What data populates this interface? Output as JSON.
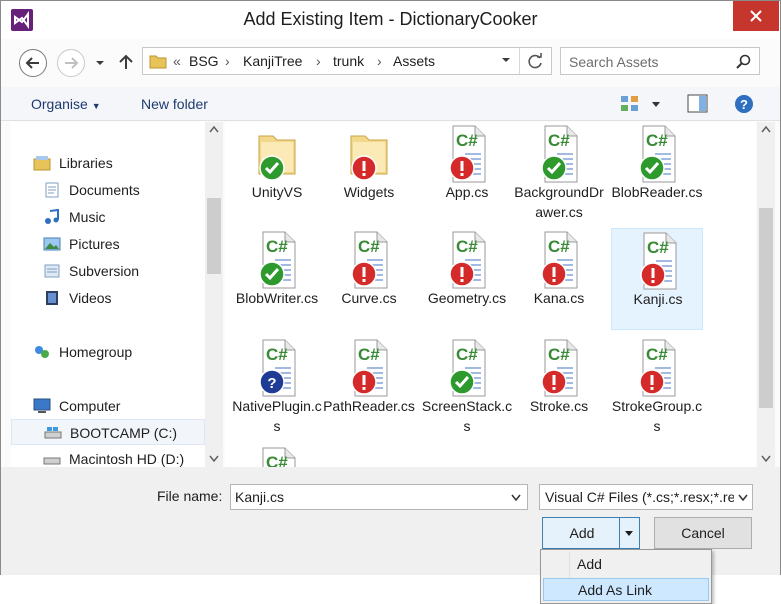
{
  "window": {
    "title": "Add Existing Item - DictionaryCooker"
  },
  "address": {
    "chevrons": "«",
    "crumbs": [
      "BSG",
      "KanjiTree",
      "trunk",
      "Assets"
    ]
  },
  "search": {
    "placeholder": "Search Assets"
  },
  "toolbar": {
    "organise_label": "Organise",
    "new_folder_label": "New folder"
  },
  "nav_pane": {
    "items": [
      {
        "label": "Libraries",
        "icon": "libraries-icon"
      },
      {
        "label": "Documents",
        "icon": "documents-icon"
      },
      {
        "label": "Music",
        "icon": "music-icon"
      },
      {
        "label": "Pictures",
        "icon": "pictures-icon"
      },
      {
        "label": "Subversion",
        "icon": "subversion-icon"
      },
      {
        "label": "Videos",
        "icon": "videos-icon"
      },
      {
        "label": "Homegroup",
        "icon": "homegroup-icon"
      },
      {
        "label": "Computer",
        "icon": "computer-icon"
      },
      {
        "label": "BOOTCAMP (C:)",
        "icon": "drive-icon"
      },
      {
        "label": "Macintosh HD (D:)",
        "icon": "drive-icon"
      }
    ]
  },
  "files": [
    {
      "name": "UnityVS",
      "kind": "folder",
      "status": "ok"
    },
    {
      "name": "Widgets",
      "kind": "folder",
      "status": "modified"
    },
    {
      "name": "App.cs",
      "kind": "cs",
      "status": "modified"
    },
    {
      "name": "BackgroundDrawer.cs",
      "kind": "cs",
      "status": "ok"
    },
    {
      "name": "BlobReader.cs",
      "kind": "cs",
      "status": "ok"
    },
    {
      "name": "BlobWriter.cs",
      "kind": "cs",
      "status": "ok"
    },
    {
      "name": "Curve.cs",
      "kind": "cs",
      "status": "modified"
    },
    {
      "name": "Geometry.cs",
      "kind": "cs",
      "status": "modified"
    },
    {
      "name": "Kana.cs",
      "kind": "cs",
      "status": "modified"
    },
    {
      "name": "Kanji.cs",
      "kind": "cs",
      "status": "modified"
    },
    {
      "name": "NativePlugin.cs",
      "kind": "cs",
      "status": "unversioned"
    },
    {
      "name": "PathReader.cs",
      "kind": "cs",
      "status": "modified"
    },
    {
      "name": "ScreenStack.cs",
      "kind": "cs",
      "status": "ok"
    },
    {
      "name": "Stroke.cs",
      "kind": "cs",
      "status": "modified"
    },
    {
      "name": "StrokeGroup.cs",
      "kind": "cs",
      "status": "modified"
    },
    {
      "name": "",
      "kind": "cs",
      "status": "none"
    }
  ],
  "footer": {
    "file_name_label": "File name:",
    "file_name_value": "Kanji.cs",
    "file_type_value": "Visual C# Files (*.cs;*.resx;*.resw;*.xsd;*.wsdl;*.xaml;*.xml)",
    "add_label": "Add",
    "cancel_label": "Cancel"
  },
  "add_menu": {
    "items": [
      "Add",
      "Add As Link"
    ]
  },
  "colors": {
    "accent": "#68217a",
    "close": "#c7362d",
    "ok": "#2e9a2e",
    "modified": "#d42a2a",
    "unversioned": "#1e3c96"
  }
}
